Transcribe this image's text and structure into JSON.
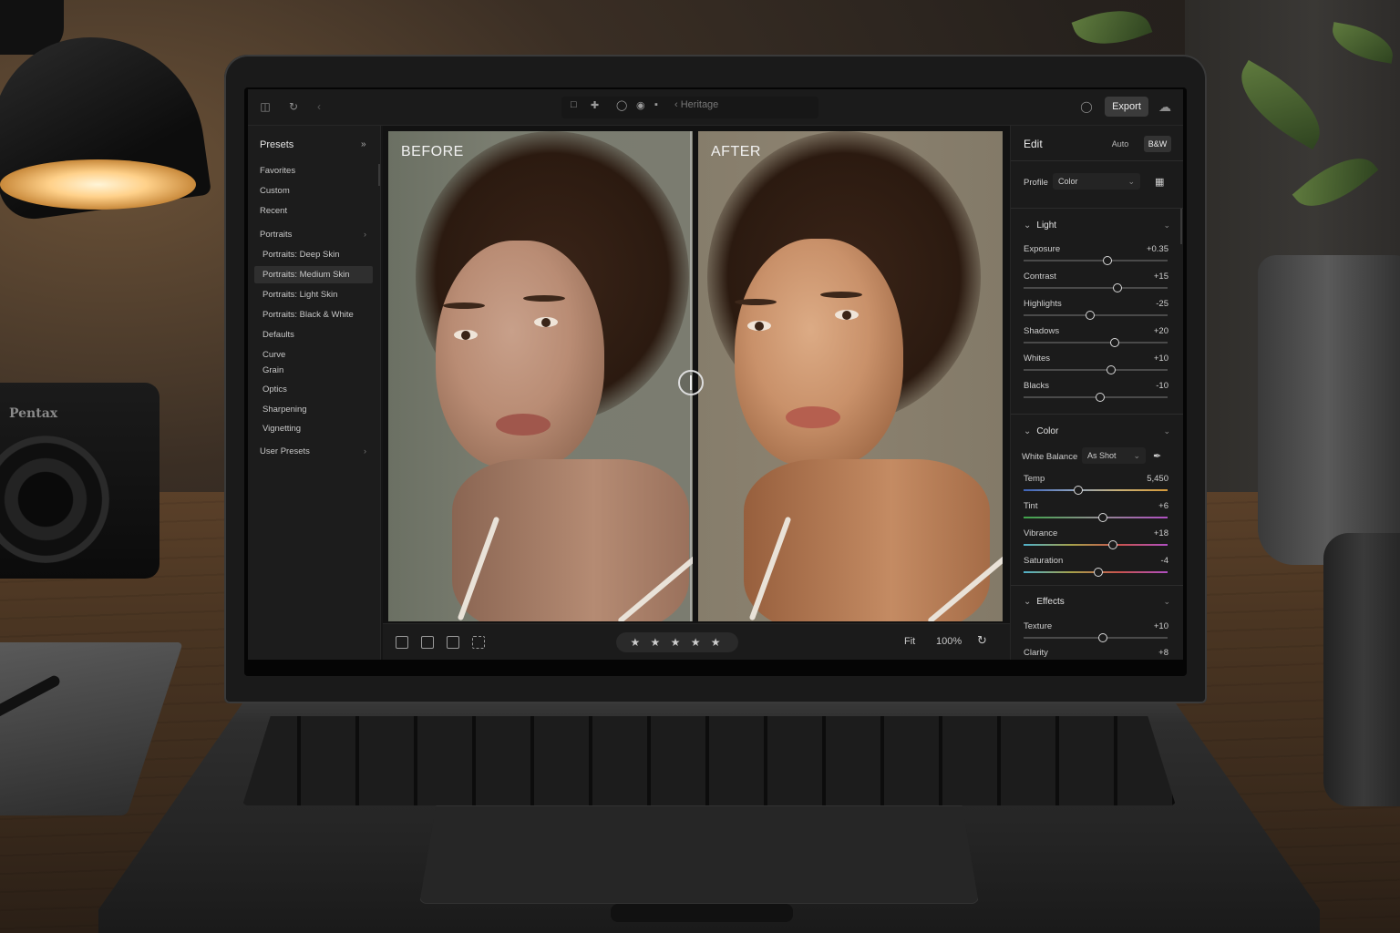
{
  "background": {
    "camera_brand": "Pentax"
  },
  "topbar": {
    "center_text": "‹ Heritage",
    "export_label": "Export",
    "icons": [
      "panel-icon",
      "rotate-icon",
      "crop-icon",
      "heal-icon",
      "mask-icon",
      "redeye-icon",
      "ratio-icon",
      "feedback-icon",
      "cloud-icon"
    ]
  },
  "presets": {
    "title": "Presets",
    "items": [
      {
        "label": "Favorites",
        "indent": false,
        "chevron": false,
        "selected": false
      },
      {
        "label": "Custom",
        "indent": false,
        "chevron": false,
        "selected": false
      },
      {
        "label": "Recent",
        "indent": false,
        "chevron": false,
        "selected": false
      },
      {
        "label": "Portraits",
        "indent": false,
        "chevron": true,
        "selected": false
      },
      {
        "label": "Portraits: Deep Skin",
        "indent": true,
        "chevron": false,
        "selected": false
      },
      {
        "label": "Portraits: Medium Skin",
        "indent": true,
        "chevron": false,
        "selected": true
      },
      {
        "label": "Portraits: Light Skin",
        "indent": true,
        "chevron": false,
        "selected": false
      },
      {
        "label": "Portraits: Black & White",
        "indent": true,
        "chevron": false,
        "selected": false
      },
      {
        "label": "Defaults",
        "indent": true,
        "chevron": false,
        "selected": false
      },
      {
        "label": "Curve",
        "indent": true,
        "chevron": false,
        "selected": false
      },
      {
        "label": "Grain",
        "indent": true,
        "chevron": false,
        "selected": false
      },
      {
        "label": "Optics",
        "indent": true,
        "chevron": false,
        "selected": false
      },
      {
        "label": "Sharpening",
        "indent": true,
        "chevron": false,
        "selected": false
      },
      {
        "label": "Vignetting",
        "indent": true,
        "chevron": false,
        "selected": false
      },
      {
        "label": "User Presets",
        "indent": false,
        "chevron": true,
        "selected": false
      }
    ]
  },
  "view": {
    "before_label": "BEFORE",
    "after_label": "AFTER"
  },
  "filmstrip": {
    "rating": "★ ★ ★ ★ ★",
    "fit_label": "Fit",
    "zoom_label": "100%"
  },
  "edit": {
    "title": "Edit",
    "auto_label": "Auto",
    "bw_label": "B&W",
    "profile_label": "Profile",
    "profile_value": "Color",
    "light": {
      "title": "Light",
      "sliders": [
        {
          "label": "Exposure",
          "value_text": "+0.35",
          "pos": 0.58
        },
        {
          "label": "Contrast",
          "value_text": "+15",
          "pos": 0.65
        },
        {
          "label": "Highlights",
          "value_text": "-25",
          "pos": 0.46
        },
        {
          "label": "Shadows",
          "value_text": "+20",
          "pos": 0.63
        },
        {
          "label": "Whites",
          "value_text": "+10",
          "pos": 0.61
        },
        {
          "label": "Blacks",
          "value_text": "-10",
          "pos": 0.53
        }
      ]
    },
    "color": {
      "title": "Color",
      "wb_label": "White Balance",
      "wb_value": "As Shot",
      "sliders": [
        {
          "label": "Temp",
          "value_text": "5,450",
          "pos": 0.38,
          "track": "temp"
        },
        {
          "label": "Tint",
          "value_text": "+6",
          "pos": 0.55,
          "track": "tint"
        },
        {
          "label": "Vibrance",
          "value_text": "+18",
          "pos": 0.62,
          "track": "sat"
        },
        {
          "label": "Saturation",
          "value_text": "-4",
          "pos": 0.52,
          "track": "sat"
        }
      ]
    },
    "effects": {
      "title": "Effects",
      "sliders": [
        {
          "label": "Texture",
          "value_text": "+10",
          "pos": 0.55
        },
        {
          "label": "Clarity",
          "value_text": "+8",
          "pos": 0.53
        }
      ]
    }
  }
}
